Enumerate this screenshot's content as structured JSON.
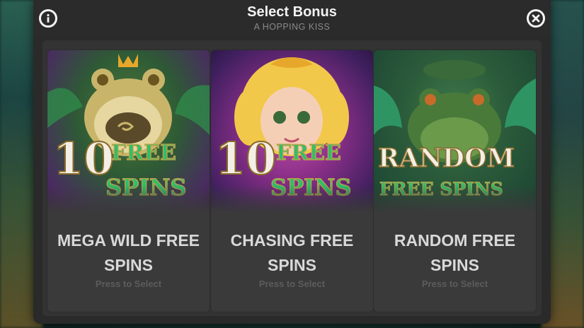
{
  "dialog": {
    "title": "Select Bonus",
    "subtitle": "A HOPPING KISS",
    "info_icon": "info-icon",
    "close_icon": "close-icon"
  },
  "cards": [
    {
      "art_line1": "10",
      "art_line2": "FREE",
      "art_line3": "SPINS",
      "name": "MEGA WILD FREE SPINS",
      "hint": "Press to Select",
      "character": "golden-frog"
    },
    {
      "art_line1": "10",
      "art_line2": "FREE",
      "art_line3": "SPINS",
      "name": "CHASING FREE SPINS",
      "hint": "Press to Select",
      "character": "princess"
    },
    {
      "art_line1": "RANDOM",
      "art_line2": "FREE SPINS",
      "name": "RANDOM FREE SPINS",
      "hint": "Press to Select",
      "character": "green-frog"
    }
  ],
  "colors": {
    "panel": "#2a2a2a",
    "card": "#3a3a3a",
    "title": "#f2f2f2",
    "subtitle": "#8a8a8a",
    "card_text": "#d9d9d9",
    "hint": "#5c5c5c",
    "gold": "#e9c35a",
    "green_text": "#2fbf6a"
  }
}
